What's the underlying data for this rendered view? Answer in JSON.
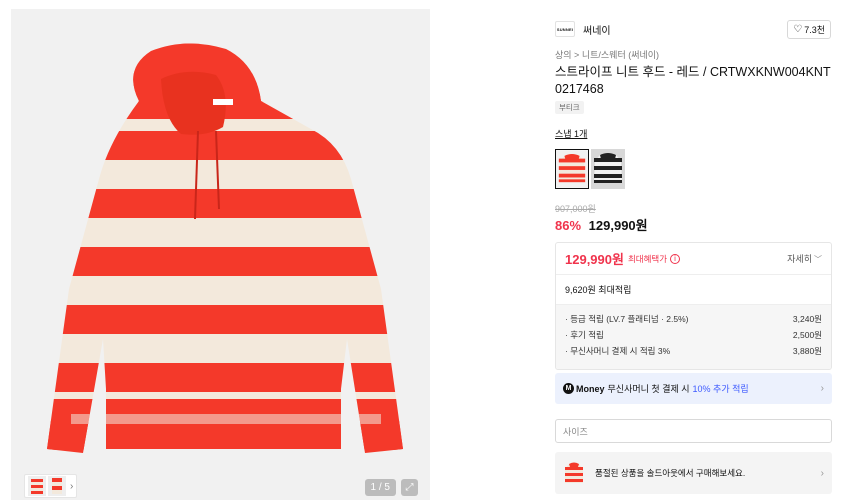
{
  "gallery": {
    "image_alt": "Red and cream striped knit hoodie",
    "counter": "1 / 5",
    "expand_icon": "expand-icon",
    "thumb_chevron": "›"
  },
  "brand": {
    "logo_text": "SUNNEI",
    "name": "써네이",
    "likes": "7.3천"
  },
  "product": {
    "breadcrumb": "상의 > 니트/스웨터 (써네이)",
    "title": "스트라이프 니트 후드 - 레드 / CRTWXKNW004KNT0217468",
    "tag": "부티크",
    "snap_link": "스냅 1개",
    "original_price": "907,000원",
    "discount": "86%",
    "price": "129,990원"
  },
  "benefits": {
    "max_price": "129,990원",
    "max_label": "최대혜택가",
    "info_icon": "i",
    "detail_label": "자세히",
    "points_total": "9,620원 최대적립",
    "rows": [
      {
        "label": "· 등급 적립 (LV.7 플래티넘 · 2.5%)",
        "value": "3,240원"
      },
      {
        "label": "· 후기 적립",
        "value": "2,500원"
      },
      {
        "label": "· 무신사머니 결제 시 적립 3%",
        "value": "3,880원"
      }
    ]
  },
  "money_banner": {
    "logo": "M",
    "brand": "Money",
    "text": "무신사머니 첫 결제 시",
    "highlight": "10% 추가 적립"
  },
  "size_select": {
    "placeholder": "사이즈"
  },
  "soldout_banner": {
    "text": "품절된 상품을 솔드아웃에서 구매해보세요."
  },
  "colors": {
    "accent_red": "#f0334c",
    "money_blue": "#3d5afe",
    "stripe_red": "#f4392a",
    "stripe_cream": "#f3e9dc"
  }
}
